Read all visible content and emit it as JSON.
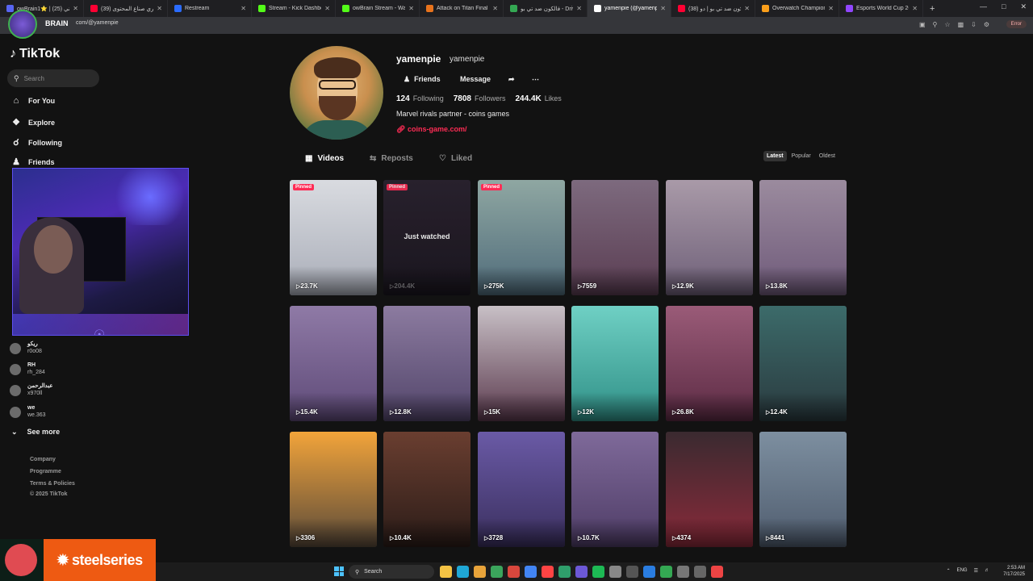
{
  "browser": {
    "tabs": [
      {
        "label": "owBrain1⭐ | برني (25)",
        "color": "#5865f2",
        "active": false
      },
      {
        "label": "(39) دوري صناع المحتوى",
        "color": "#ff0033",
        "active": false
      },
      {
        "label": "Restream",
        "color": "#2b6cff",
        "active": false
      },
      {
        "label": "Stream - Kick Dashboard",
        "color": "#53fc18",
        "active": false
      },
      {
        "label": "owBrain Stream - Watch L",
        "color": "#53fc18",
        "active": false
      },
      {
        "label": "Attack on Titan Final Sea",
        "color": "#e8731c",
        "active": false
      },
      {
        "label": "فالكون ضد تي بو - Drive",
        "color": "#34a853",
        "active": false
      },
      {
        "label": "yamenpie (@yamenpie)",
        "color": "#ffffff",
        "active": true
      },
      {
        "label": "(38) فالكون ضد تي بو | دو",
        "color": "#ff0033",
        "active": false
      },
      {
        "label": "Overwatch Champions Se",
        "color": "#f99e1a",
        "active": false
      },
      {
        "label": "Esports World Cup 2025",
        "color": "#9146ff",
        "active": false
      }
    ],
    "new_tab": "+",
    "url": "com/@yamenpie",
    "error_label": "Error"
  },
  "stream_overlay": {
    "brand_label": "BRAIN",
    "sponsor": "steelseries"
  },
  "sidebar": {
    "logo": "TikTok",
    "search_placeholder": "Search",
    "nav": [
      {
        "label": "For You",
        "icon": "home-icon"
      },
      {
        "label": "Explore",
        "icon": "compass-icon"
      },
      {
        "label": "Following",
        "icon": "following-icon"
      },
      {
        "label": "Friends",
        "icon": "friends-icon"
      }
    ],
    "following_accounts": [
      {
        "name": "ريكو",
        "handle": "r0o08",
        "verified": true
      },
      {
        "name": "RH",
        "handle": "rh_284",
        "verified": false
      },
      {
        "name": "عبدالرحمن",
        "handle": "x970ll",
        "verified": false
      },
      {
        "name": "we",
        "handle": "we.363",
        "verified": false
      }
    ],
    "see_more": "See more",
    "footer": [
      "Company",
      "Programme",
      "Terms & Policies",
      "© 2025 TikTok"
    ]
  },
  "profile": {
    "username": "yamenpie",
    "nickname": "yamenpie",
    "friends_button": "Friends",
    "message_button": "Message",
    "following_count": "124",
    "following_label": "Following",
    "followers_count": "7808",
    "followers_label": "Followers",
    "likes_count": "244.4K",
    "likes_label": "Likes",
    "bio": "Marvel rivals partner - coins games",
    "link": "coins-game.com/"
  },
  "content_tabs": {
    "videos": "Videos",
    "reposts": "Reposts",
    "liked": "Liked",
    "sort": [
      "Latest",
      "Popular",
      "Oldest"
    ],
    "sort_active": "Latest"
  },
  "videos": [
    {
      "views": "23.7K",
      "pinned": true,
      "thumb": [
        "#d9dbe0",
        "#a9adb8"
      ]
    },
    {
      "views": "204.4K",
      "pinned": true,
      "watched": "Just watched",
      "thumb": [
        "#2b2330",
        "#1b1620"
      ]
    },
    {
      "views": "275K",
      "pinned": true,
      "thumb": [
        "#8fa7a2",
        "#4f6b7a"
      ]
    },
    {
      "views": "7559",
      "pinned": false,
      "thumb": [
        "#7d6a7e",
        "#5a3d52"
      ]
    },
    {
      "views": "12.9K",
      "pinned": false,
      "thumb": [
        "#a99aa8",
        "#6e5f78"
      ]
    },
    {
      "views": "13.8K",
      "pinned": false,
      "thumb": [
        "#9b8b9e",
        "#6f5a7a"
      ]
    },
    {
      "views": "15.4K",
      "pinned": false,
      "thumb": [
        "#8f7aa6",
        "#5e4a78"
      ]
    },
    {
      "views": "12.8K",
      "pinned": false,
      "thumb": [
        "#8c7ba0",
        "#52456a"
      ]
    },
    {
      "views": "15K",
      "pinned": false,
      "thumb": [
        "#c8c0c6",
        "#5b3a4e"
      ]
    },
    {
      "views": "12K",
      "pinned": false,
      "thumb": [
        "#6fd0c4",
        "#2f8f86"
      ]
    },
    {
      "views": "26.8K",
      "pinned": false,
      "thumb": [
        "#9a5b78",
        "#5c2b44"
      ]
    },
    {
      "views": "12.4K",
      "pinned": false,
      "thumb": [
        "#3c6b6a",
        "#2a3a3f"
      ]
    },
    {
      "views": "3306",
      "pinned": false,
      "thumb": [
        "#f2a43a",
        "#5a4a3a"
      ]
    },
    {
      "views": "10.4K",
      "pinned": false,
      "thumb": [
        "#6a3e30",
        "#2b1c18"
      ]
    },
    {
      "views": "3728",
      "pinned": false,
      "thumb": [
        "#6a5aa6",
        "#3a2f5e"
      ]
    },
    {
      "views": "10.7K",
      "pinned": false,
      "thumb": [
        "#7f6a9a",
        "#4e3c66"
      ]
    },
    {
      "views": "4374",
      "pinned": false,
      "thumb": [
        "#3a2a30",
        "#8a2a3a"
      ]
    },
    {
      "views": "8441",
      "pinned": false,
      "thumb": [
        "#7d8fa0",
        "#4f5c6e"
      ]
    }
  ],
  "taskbar": {
    "search": "Search",
    "lang": "ENG",
    "time": "2:53 AM",
    "date": "7/17/2025"
  }
}
